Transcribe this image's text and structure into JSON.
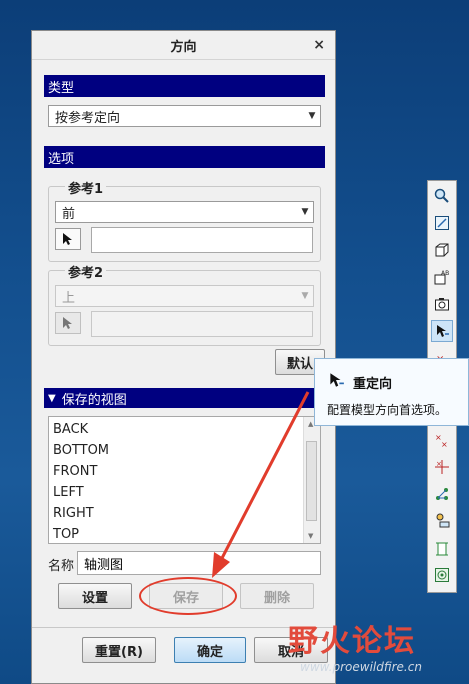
{
  "dialog": {
    "title": "方向",
    "close_glyph": "×",
    "type_header": "类型",
    "type_value": "按参考定向",
    "options_header": "选项",
    "ref1": {
      "title": "参考1",
      "value": "前"
    },
    "ref2": {
      "title": "参考2",
      "value": "上"
    },
    "default_button": "默认",
    "saved_views_header": "保存的视图",
    "saved_views": [
      "BACK",
      "BOTTOM",
      "FRONT",
      "LEFT",
      "RIGHT",
      "TOP"
    ],
    "name_label": "名称",
    "name_value": "轴测图",
    "set_button": "设置",
    "save_button": "保存",
    "delete_button": "删除",
    "reset_button": "重置(R)",
    "ok_button": "确定",
    "cancel_button": "取消"
  },
  "tooltip": {
    "title": "重定向",
    "description": "配置模型方向首选项。"
  },
  "toolbar": {
    "icons": [
      "zoom-icon",
      "refit-icon",
      "shaded-box-icon",
      "annotation-icon",
      "camera-icon",
      "reorient-icon",
      "datum-plane-icon",
      "datum-axis-icon",
      "datum-point-icon",
      "csys-icon",
      "sketch-icon",
      "spin-center-icon",
      "model-display-icon"
    ]
  },
  "watermark": {
    "brand": "野火论坛",
    "site": "www.proewildfire.cn"
  },
  "colors": {
    "section_header": "#000080",
    "annotation_red": "#e13c2c",
    "desktop": "#134f8e"
  }
}
